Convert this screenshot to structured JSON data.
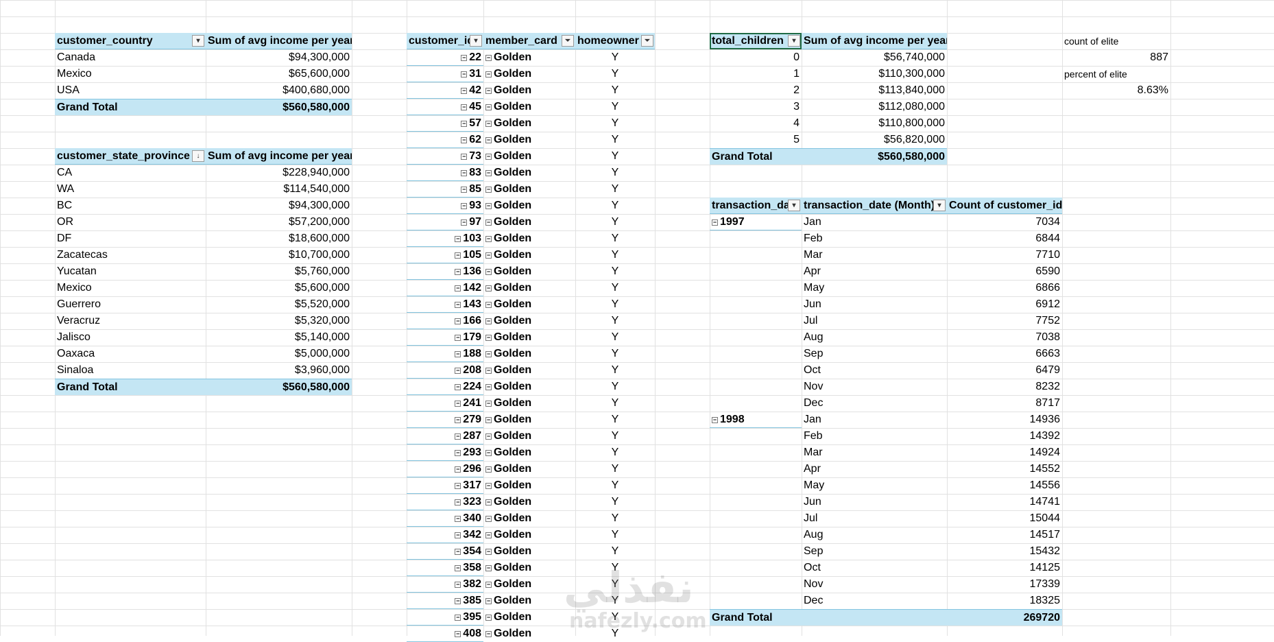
{
  "pivot_country": {
    "headers": [
      "customer_country",
      "Sum of avg income per year"
    ],
    "rows": [
      [
        "Canada",
        "$94,300,000"
      ],
      [
        "Mexico",
        "$65,600,000"
      ],
      [
        "USA",
        "$400,680,000"
      ]
    ],
    "grand_total": [
      "Grand Total",
      "$560,580,000"
    ]
  },
  "pivot_state": {
    "headers": [
      "customer_state_province",
      "Sum of avg income per year"
    ],
    "rows": [
      [
        "CA",
        "$228,940,000"
      ],
      [
        "WA",
        "$114,540,000"
      ],
      [
        "BC",
        "$94,300,000"
      ],
      [
        "OR",
        "$57,200,000"
      ],
      [
        "DF",
        "$18,600,000"
      ],
      [
        "Zacatecas",
        "$10,700,000"
      ],
      [
        "Yucatan",
        "$5,760,000"
      ],
      [
        "Mexico",
        "$5,600,000"
      ],
      [
        "Guerrero",
        "$5,520,000"
      ],
      [
        "Veracruz",
        "$5,320,000"
      ],
      [
        "Jalisco",
        "$5,140,000"
      ],
      [
        "Oaxaca",
        "$5,000,000"
      ],
      [
        "Sinaloa",
        "$3,960,000"
      ]
    ],
    "grand_total": [
      "Grand Total",
      "$560,580,000"
    ]
  },
  "pivot_customers": {
    "headers": [
      "customer_id",
      "member_card",
      "homeowner"
    ],
    "ids": [
      "22",
      "31",
      "42",
      "45",
      "57",
      "62",
      "73",
      "83",
      "85",
      "93",
      "97",
      "103",
      "105",
      "136",
      "142",
      "143",
      "166",
      "179",
      "188",
      "208",
      "224",
      "241",
      "279",
      "287",
      "293",
      "296",
      "317",
      "323",
      "340",
      "342",
      "354",
      "358",
      "382",
      "385",
      "395",
      "408"
    ],
    "member_card": "Golden",
    "homeowner": "Y"
  },
  "pivot_children": {
    "headers": [
      "total_children",
      "Sum of avg income per year"
    ],
    "rows": [
      [
        "0",
        "$56,740,000"
      ],
      [
        "1",
        "$110,300,000"
      ],
      [
        "2",
        "$113,840,000"
      ],
      [
        "3",
        "$112,080,000"
      ],
      [
        "4",
        "$110,800,000"
      ],
      [
        "5",
        "$56,820,000"
      ]
    ],
    "grand_total": [
      "Grand Total",
      "$560,580,000"
    ]
  },
  "elite": {
    "count_label": "count of elite",
    "count_value": "887",
    "percent_label": "percent of elite",
    "percent_value": "8.63%"
  },
  "pivot_dates": {
    "headers": [
      "transaction_date",
      "transaction_date (Month)",
      "Count of customer_id"
    ],
    "years": [
      {
        "year": "1997",
        "months": [
          [
            "Jan",
            "7034"
          ],
          [
            "Feb",
            "6844"
          ],
          [
            "Mar",
            "7710"
          ],
          [
            "Apr",
            "6590"
          ],
          [
            "May",
            "6866"
          ],
          [
            "Jun",
            "6912"
          ],
          [
            "Jul",
            "7752"
          ],
          [
            "Aug",
            "7038"
          ],
          [
            "Sep",
            "6663"
          ],
          [
            "Oct",
            "6479"
          ],
          [
            "Nov",
            "8232"
          ],
          [
            "Dec",
            "8717"
          ]
        ]
      },
      {
        "year": "1998",
        "months": [
          [
            "Jan",
            "14936"
          ],
          [
            "Feb",
            "14392"
          ],
          [
            "Mar",
            "14924"
          ],
          [
            "Apr",
            "14552"
          ],
          [
            "May",
            "14556"
          ],
          [
            "Jun",
            "14741"
          ],
          [
            "Jul",
            "15044"
          ],
          [
            "Aug",
            "14517"
          ],
          [
            "Sep",
            "15432"
          ],
          [
            "Oct",
            "14125"
          ],
          [
            "Nov",
            "17339"
          ],
          [
            "Dec",
            "18325"
          ]
        ]
      }
    ],
    "grand_total": [
      "Grand Total",
      "269720"
    ]
  },
  "watermark": {
    "arabic": "نفذلي",
    "latin": "nafezly.com"
  },
  "colors": {
    "pivot_header_bg": "#c4e6f4",
    "gridline": "#e1e1e1",
    "selection": "#1f6b44"
  },
  "icons": {
    "filter_dropdown": "dropdown-arrow-icon",
    "filter_active": "filter-funnel-icon",
    "sort_desc": "sort-descending-icon",
    "collapse": "collapse-minus-icon"
  }
}
